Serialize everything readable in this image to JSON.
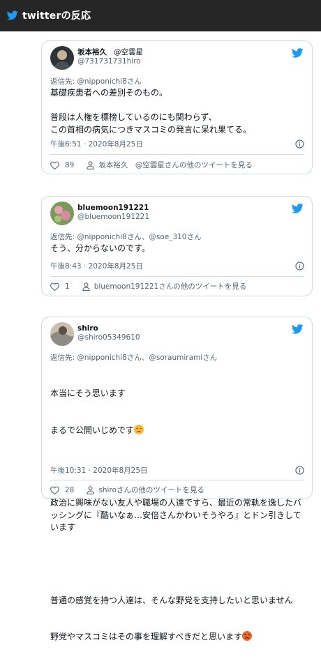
{
  "header": {
    "title": "twitterの反応"
  },
  "tweets": [
    {
      "display_name": "坂本裕久",
      "display_suffix": "@空雲星",
      "handle": "@731731731hiro",
      "reply_to_prefix": "返信先: ",
      "reply_to": "@nipponichi8さん",
      "text": "基礎疾患者への差別そのもの。\n\n普段は人権を標榜しているのにも関わらず、\nこの首相の病気につきマスコミの発言に呆れ果てる。",
      "timestamp": "午後6:51 · 2020年8月25日",
      "like_count": "89",
      "more_link": "坂本裕久　@空雲星さんの他のツイートを見る",
      "avatar_color": "#3a3f44"
    },
    {
      "display_name": "bluemoon191221",
      "display_suffix": "",
      "handle": "@bluemoon191221",
      "reply_to_prefix": "返信先: ",
      "reply_to": "@nipponichi8さん、@soe_310さん",
      "text": "そう、分からないのです。",
      "timestamp": "午後8:43 · 2020年8月25日",
      "like_count": "1",
      "more_link": "bluemoon191221さんの他のツイートを見る",
      "avatar_color": "#6d8f4e"
    },
    {
      "display_name": "shiro",
      "display_suffix": "",
      "handle": "@shiro05349610",
      "reply_to_prefix": "返信先: ",
      "reply_to": "@nipponichi8さん、@soraumiramiさん",
      "text_line_1": "本当にそう思います",
      "text_line_2": "まるで公開いじめです",
      "text_para_2": "政治に興味がない友人や職場の人達ですら、最近の常軌を逸したバッシングに『酷いなぁ…安倍さんかわいそうやろ』とドン引きしています",
      "text_line_5": "普通の感覚を持つ人達は、そんな野党を支持したいと思いません",
      "text_line_6": "野党やマスコミはその事を理解すべきだと思います",
      "timestamp": "午後10:31 · 2020年8月25日",
      "like_count": "28",
      "more_link": "shiroさんの他のツイートを見る",
      "avatar_color": "#b8a58c"
    }
  ],
  "colors": {
    "twitter_blue": "#1d9bf0",
    "header_bg": "#262626"
  },
  "icons": [
    "twitter-bird-icon",
    "info-icon",
    "heart-icon",
    "person-icon",
    "persevering-face-emoji",
    "angry-face-emoji"
  ]
}
